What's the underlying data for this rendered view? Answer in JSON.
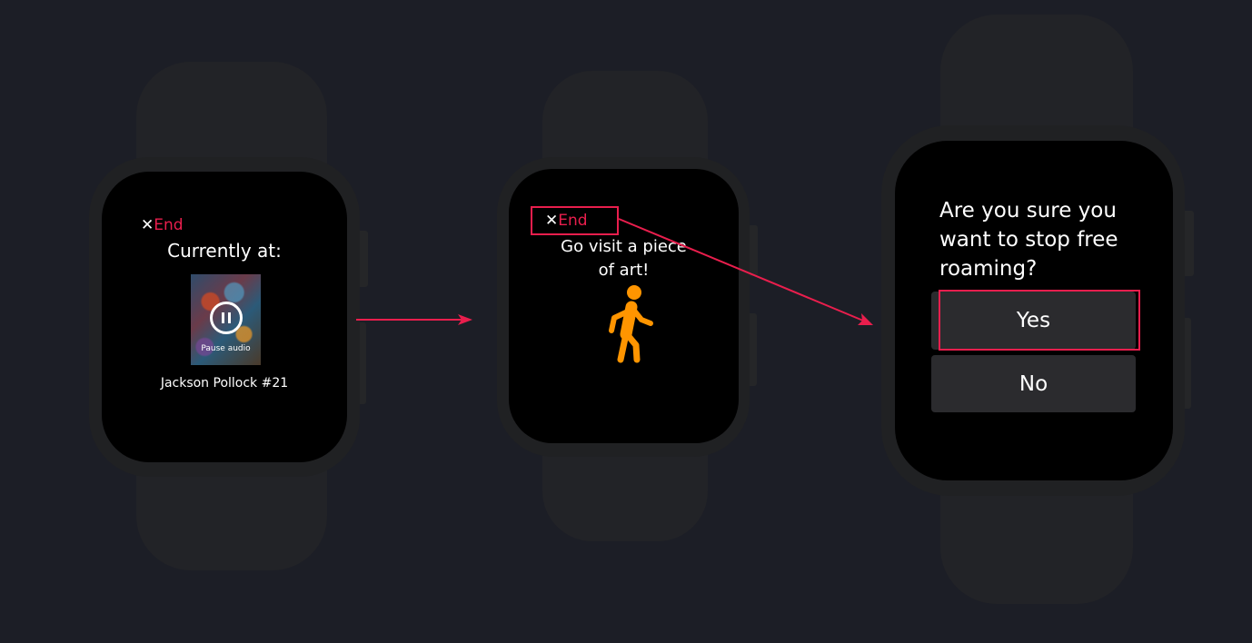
{
  "colors": {
    "background": "#1c1e26",
    "accent": "#e91e4d",
    "walking_icon": "#ff9500",
    "button": "#2b2b2e"
  },
  "watch1": {
    "end_label": "End",
    "heading": "Currently at:",
    "pause_label": "Pause audio",
    "artwork_title": "Jackson Pollock #21"
  },
  "watch2": {
    "end_label": "End",
    "message_line1": "Go visit a piece",
    "message_line2": "of art!",
    "icon": "walking-person-icon"
  },
  "watch3": {
    "question_line1": "Are you sure you",
    "question_line2": "want to stop free",
    "question_line3": "roaming?",
    "yes_label": "Yes",
    "no_label": "No"
  }
}
